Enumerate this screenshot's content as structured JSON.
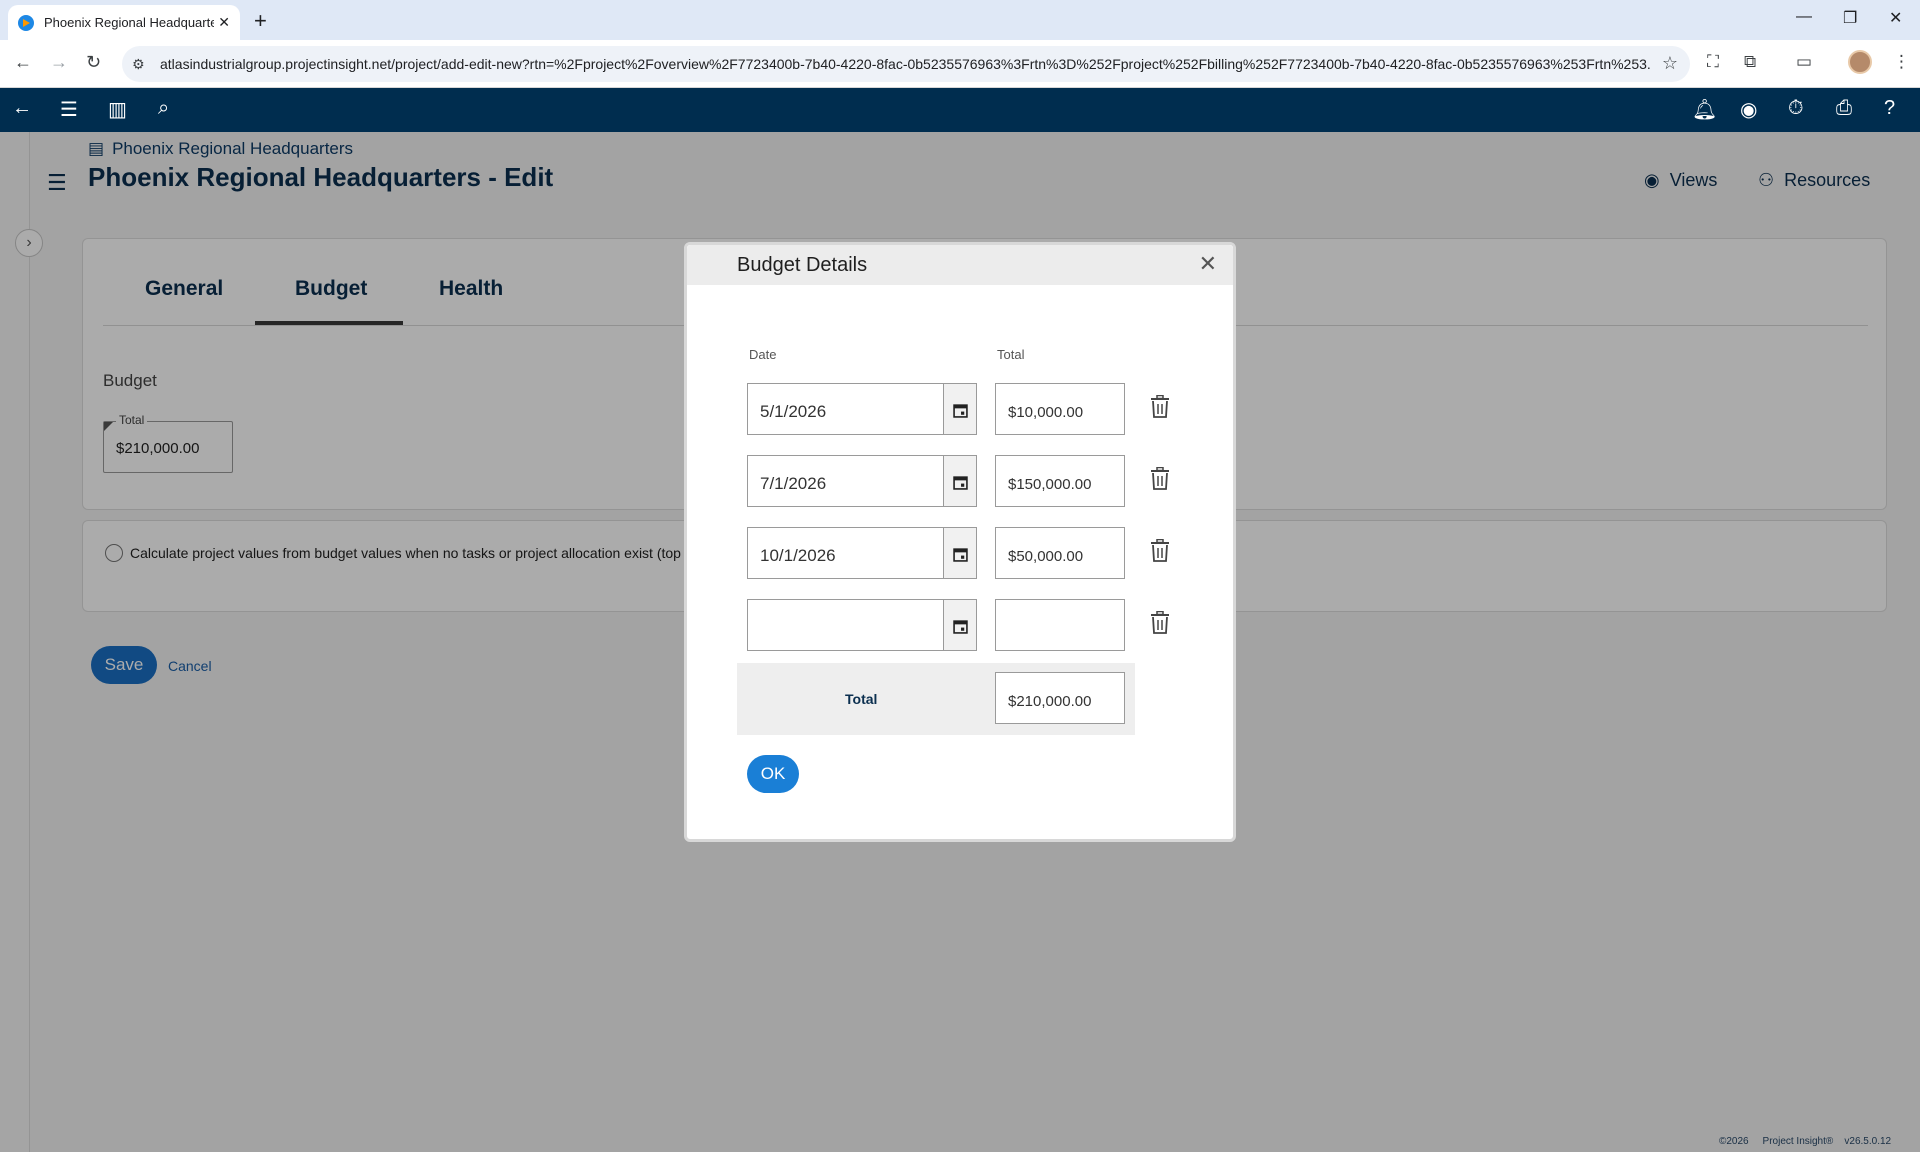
{
  "browser": {
    "tab_title": "Phoenix Regional Headquarters",
    "url": "atlasindustrialgroup.projectinsight.net/project/add-edit-new?rtn=%2Fproject%2Foverview%2F7723400b-7b40-4220-8fac-0b5235576963%3Frtn%3D%252Fproject%252Fbilling%252F7723400b-7b40-4220-8fac-0b5235576963%253Frtn%253..."
  },
  "page": {
    "breadcrumb": "Phoenix Regional Headquarters",
    "title": "Phoenix Regional Headquarters - Edit",
    "views_label": "Views",
    "resources_label": "Resources",
    "tabs": [
      {
        "label": "General",
        "active": false
      },
      {
        "label": "Budget",
        "active": true
      },
      {
        "label": "Health",
        "active": false
      }
    ],
    "budget_section_label": "Budget",
    "budget_total_legend": "Total",
    "budget_total_value": "$210,000.00",
    "calc_option_text": "Calculate project values from budget values when no tasks or project allocation exist (top do",
    "save_label": "Save",
    "cancel_label": "Cancel",
    "footer": {
      "copyright": "©2026",
      "brand": "Project Insight®",
      "version": "v26.5.0.12"
    }
  },
  "modal": {
    "title": "Budget Details",
    "date_header": "Date",
    "total_header": "Total",
    "rows": [
      {
        "date": "5/1/2026",
        "total": "$10,000.00"
      },
      {
        "date": "7/1/2026",
        "total": "$150,000.00"
      },
      {
        "date": "10/1/2026",
        "total": "$50,000.00"
      },
      {
        "date": "",
        "total": ""
      }
    ],
    "total_label": "Total",
    "total_value": "$210,000.00",
    "ok_label": "OK"
  },
  "colors": {
    "navbar": "#002d4f",
    "primary_button": "#1a6fc4",
    "title_text": "#0b2f4f"
  }
}
